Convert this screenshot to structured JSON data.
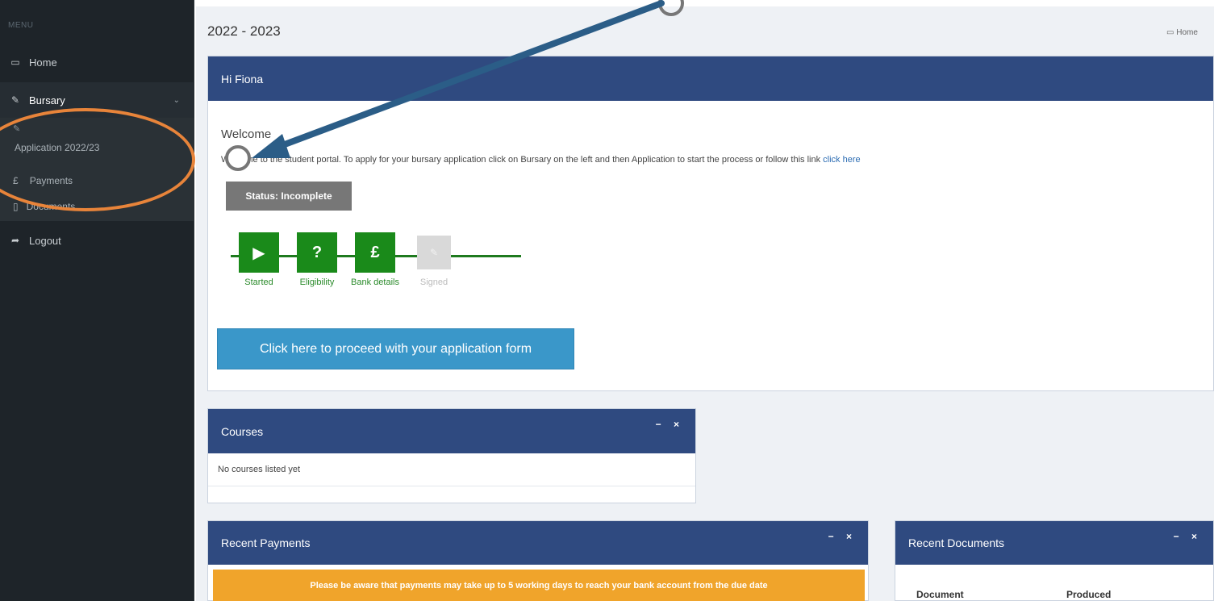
{
  "sidebar": {
    "menu_title": "MENU",
    "home": {
      "label": "Home",
      "icon": "monitor-icon"
    },
    "bursary": {
      "label": "Bursary",
      "icon": "edit-icon"
    },
    "application": {
      "label": "Application 2022/23",
      "icon": "edit-icon"
    },
    "payments": {
      "label": "Payments",
      "icon": "pound-icon"
    },
    "documents": {
      "label": "Documents",
      "icon": "file-icon"
    },
    "logout": {
      "label": "Logout",
      "icon": "share-icon"
    }
  },
  "header": {
    "year": "2022 - 2023",
    "top_right": "Home"
  },
  "welcome_panel": {
    "title": "Hi Fiona",
    "welcome": "Welcome",
    "intro_text": "Welcome to the student portal. To apply for your bursary application click on Bursary on the left and then Application to start the process or follow this link",
    "intro_link": "click here",
    "status": "Status: Incomplete",
    "steps": [
      {
        "label": "Started",
        "glyph": "▶",
        "done": true
      },
      {
        "label": "Eligibility",
        "glyph": "?",
        "done": true
      },
      {
        "label": "Bank details",
        "glyph": "£",
        "done": true
      },
      {
        "label": "Signed",
        "glyph": "✎",
        "done": false
      }
    ],
    "proceed_button": "Click here to proceed with your application form"
  },
  "courses_panel": {
    "title": "Courses",
    "empty_text": "No courses listed yet",
    "tools": "− ×"
  },
  "payments_panel": {
    "title": "Recent Payments",
    "warning": "Please be aware that payments may take up to 5 working days to reach your bank account from the due date",
    "tools": "− ×"
  },
  "documents_panel": {
    "title": "Recent Documents",
    "col_document": "Document",
    "col_produced": "Produced",
    "tools": "− ×"
  },
  "colors": {
    "sidebar_bg": "#1e2429",
    "panel_header": "#2f4a80",
    "step_done": "#1a8a1a",
    "proceed_button": "#3a97c9",
    "warning": "#f0a42b",
    "annotation_orange": "#e8843a",
    "annotation_arrow": "#2b5d87"
  }
}
